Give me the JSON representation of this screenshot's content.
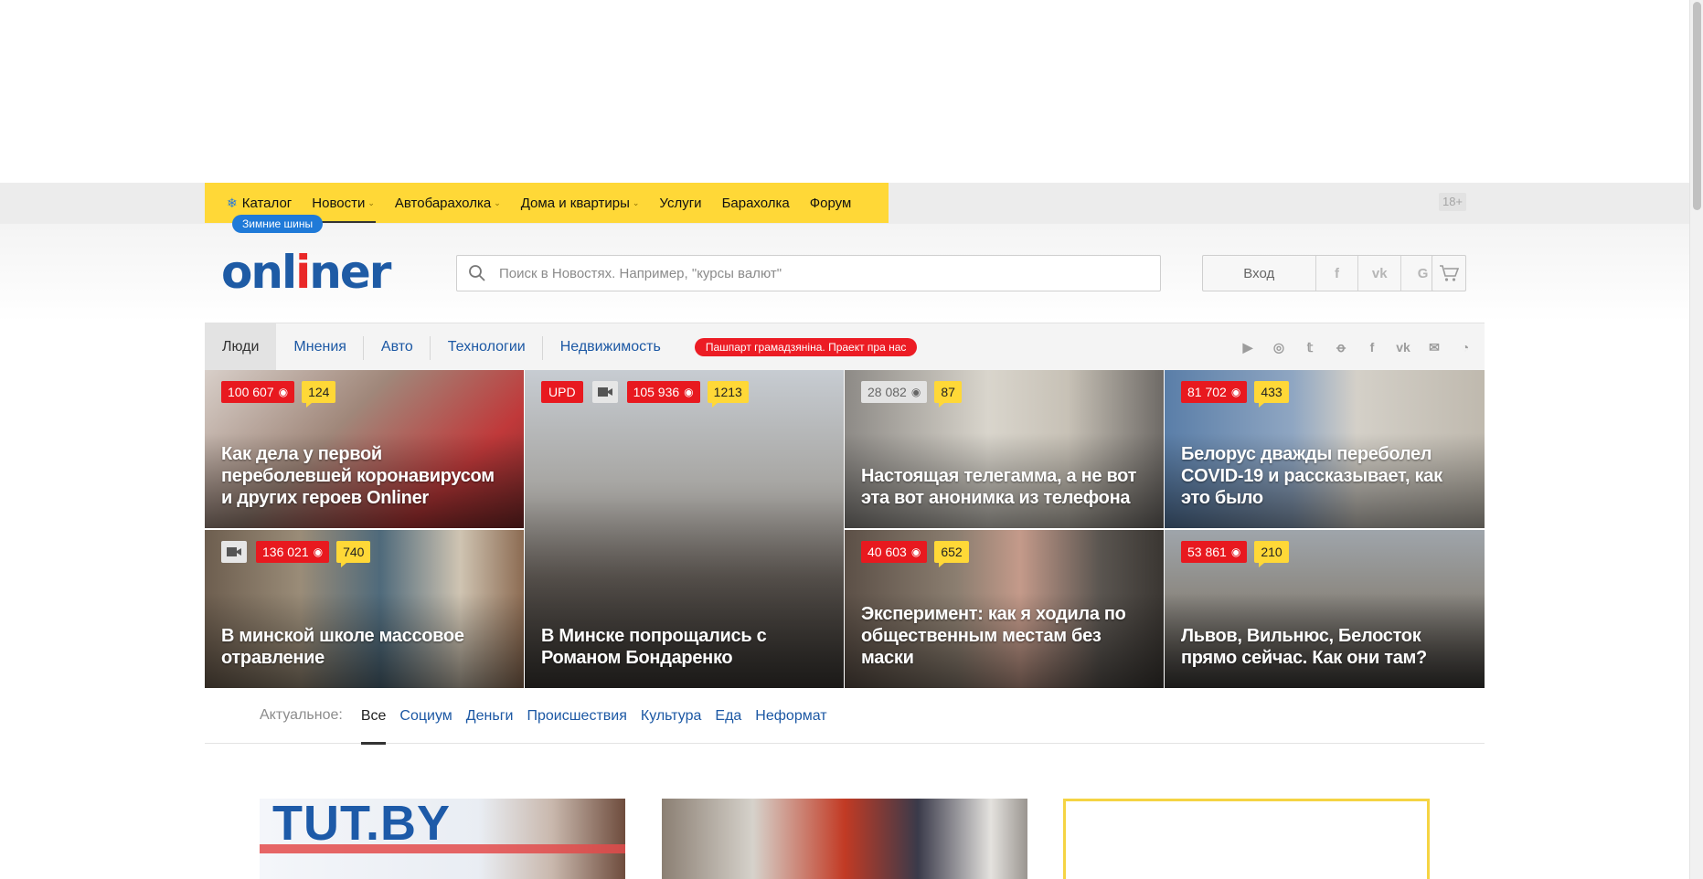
{
  "topnav": {
    "items": [
      {
        "label": "Каталог"
      },
      {
        "label": "Новости"
      },
      {
        "label": "Автобарахолка"
      },
      {
        "label": "Дома и квартиры"
      },
      {
        "label": "Услуги"
      },
      {
        "label": "Барахолка"
      },
      {
        "label": "Форум"
      }
    ],
    "promo": "Зимние шины",
    "age": "18+"
  },
  "header": {
    "logo_prefix": "onl",
    "logo_i": "i",
    "logo_suffix": "ner",
    "search_placeholder": "Поиск в Новостях. Например, \"курсы валют\"",
    "login": "Вход",
    "social": [
      "f",
      "vk",
      "G"
    ]
  },
  "sections": {
    "tabs": [
      {
        "label": "Люди"
      },
      {
        "label": "Мнения"
      },
      {
        "label": "Авто"
      },
      {
        "label": "Технологии"
      },
      {
        "label": "Недвижимость"
      }
    ],
    "special": "Пашпарт грамадзяніна. Праект пра нас",
    "social_icons": [
      "youtube-icon",
      "instagram-icon",
      "twitter-icon",
      "odnoklassniki-icon",
      "facebook-icon",
      "vk-icon",
      "mail-icon",
      "rss-icon"
    ]
  },
  "tiles": [
    {
      "views": "100 607",
      "comments": "124",
      "title": "Как дела у первой переболевшей коронавирусом и других героев Onliner"
    },
    {
      "upd": "UPD",
      "views": "105 936",
      "comments": "1213",
      "title": "В Минске попрощались с Романом Бондаренко"
    },
    {
      "views": "28 082",
      "comments": "87",
      "title": "Настоящая телегамма, а не вот эта вот анонимка из телефона"
    },
    {
      "views": "81 702",
      "comments": "433",
      "title": "Белорус дважды переболел COVID-19 и рассказывает, как это было"
    },
    {
      "views": "136 021",
      "comments": "740",
      "title": "В минской школе массовое отравление"
    },
    {
      "views": "40 603",
      "comments": "652",
      "title": "Эксперимент: как я ходила по общественным местам без маски"
    },
    {
      "views": "53 861",
      "comments": "210",
      "title": "Львов, Вильнюс, Белосток прямо сейчас. Как они там?"
    }
  ],
  "actual": {
    "label": "Актуальное:",
    "categories": [
      "Все",
      "Социум",
      "Деньги",
      "Происшествия",
      "Культура",
      "Еда",
      "Неформат"
    ]
  },
  "cards": {
    "card1_logo": "TUT.BY"
  }
}
